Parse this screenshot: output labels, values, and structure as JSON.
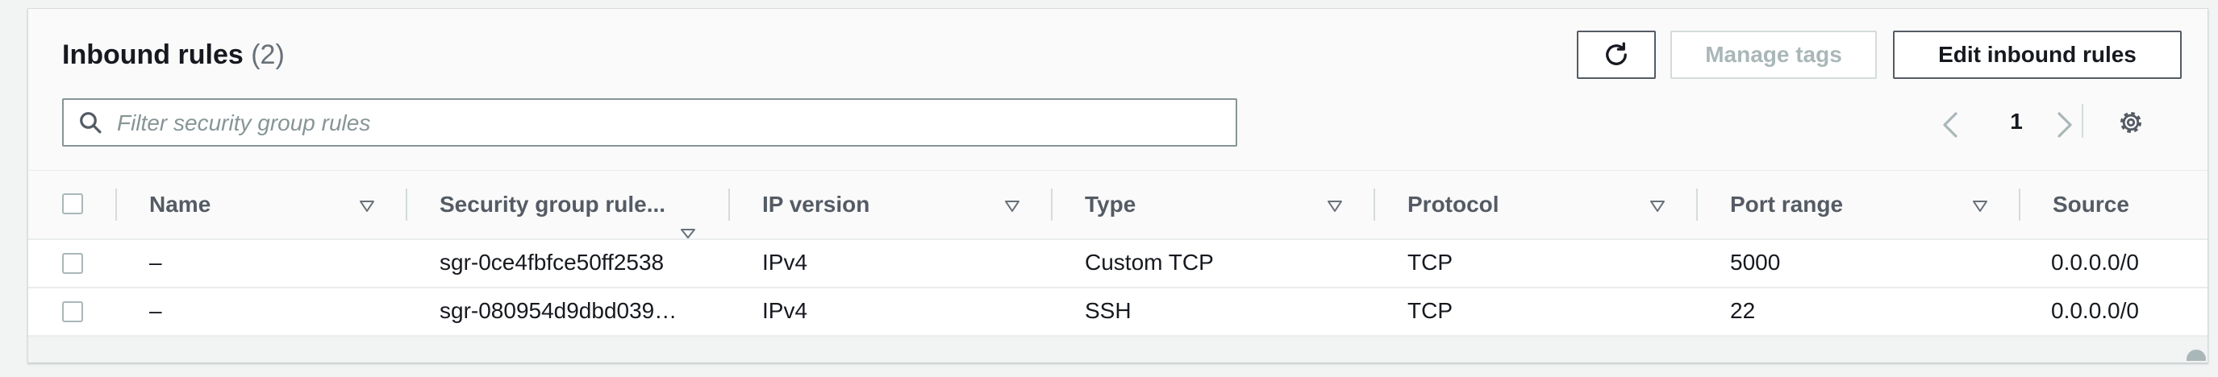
{
  "header": {
    "title": "Inbound rules",
    "count": "(2)",
    "manage_tags_label": "Manage tags",
    "edit_inbound_rules_label": "Edit inbound rules"
  },
  "icons": {
    "refresh": "refresh-icon",
    "search": "search-icon",
    "prev": "chevron-left-icon",
    "next": "chevron-right-icon",
    "settings": "gear-icon",
    "sort": "sort-triangle-icon"
  },
  "filter": {
    "placeholder": "Filter security group rules",
    "value": ""
  },
  "pagination": {
    "current_page": "1"
  },
  "table": {
    "columns": [
      "Name",
      "Security group rule...",
      "IP version",
      "Type",
      "Protocol",
      "Port range",
      "Source"
    ],
    "rows": [
      {
        "name": "–",
        "rule_id": "sgr-0ce4fbfce50ff2538",
        "ip_version": "IPv4",
        "type": "Custom TCP",
        "protocol": "TCP",
        "port_range": "5000",
        "source": "0.0.0.0/0",
        "selected": false
      },
      {
        "name": "–",
        "rule_id": "sgr-080954d9dbd039…",
        "ip_version": "IPv4",
        "type": "SSH",
        "protocol": "TCP",
        "port_range": "22",
        "source": "0.0.0.0/0",
        "selected": false
      }
    ]
  },
  "colors": {
    "panel_background": "#fafafa",
    "text": "#16191f",
    "secondary_text": "#545b64",
    "disabled": "#aab7b8",
    "border": "#d5dbdb"
  }
}
